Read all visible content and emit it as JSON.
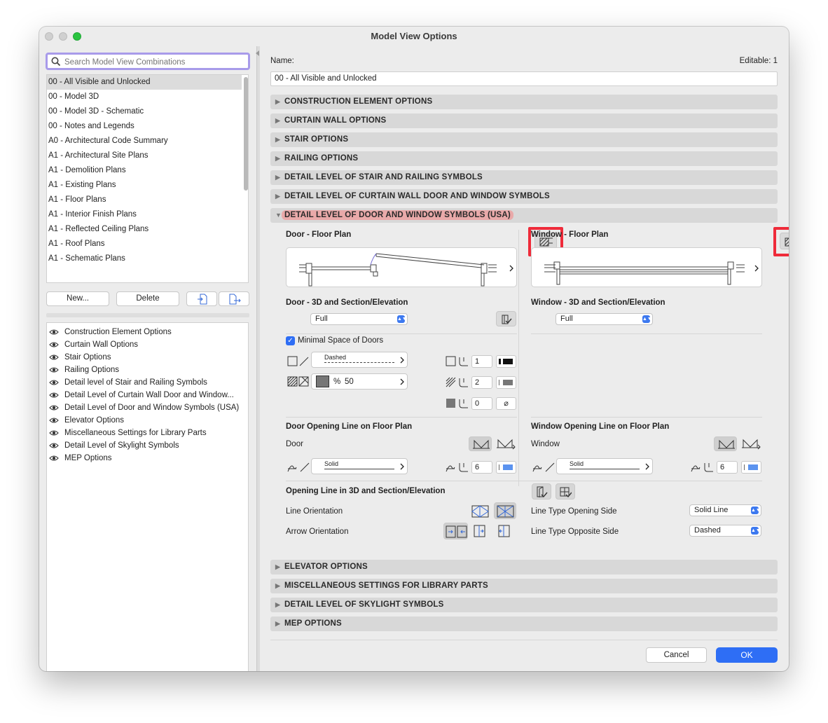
{
  "window": {
    "title": "Model View Options"
  },
  "left": {
    "search_placeholder": "Search Model View Combinations",
    "combinations": [
      "00 - All Visible and Unlocked",
      "00 - Model 3D",
      "00 - Model 3D - Schematic",
      "00 - Notes and Legends",
      "A0 - Architectural Code Summary",
      "A1 - Architectural Site Plans",
      "A1 - Demolition Plans",
      "A1 - Existing Plans",
      "A1 - Floor Plans",
      "A1 - Interior Finish Plans",
      "A1 - Reflected Ceiling Plans",
      "A1 - Roof Plans",
      "A1 - Schematic Plans"
    ],
    "new_label": "New...",
    "delete_label": "Delete",
    "option_sets": [
      "Construction Element Options",
      "Curtain Wall Options",
      "Stair Options",
      "Railing Options",
      "Detail level of Stair and Railing Symbols",
      "Detail Level of Curtain Wall Door and Window...",
      "Detail Level of Door and Window Symbols (USA)",
      "Elevator Options",
      "Miscellaneous Settings for Library Parts",
      "Detail Level of Skylight Symbols",
      "MEP Options"
    ]
  },
  "right": {
    "name_label": "Name:",
    "editable_label": "Editable: 1",
    "name_value": "00 - All Visible and Unlocked",
    "sections_top": [
      "CONSTRUCTION ELEMENT OPTIONS",
      "CURTAIN WALL OPTIONS",
      "STAIR OPTIONS",
      "RAILING OPTIONS",
      "DETAIL LEVEL OF STAIR AND RAILING SYMBOLS",
      "DETAIL LEVEL OF CURTAIN WALL DOOR AND WINDOW SYMBOLS"
    ],
    "expanded_section": "DETAIL LEVEL OF DOOR AND WINDOW SYMBOLS (USA)",
    "sections_bottom": [
      "ELEVATOR OPTIONS",
      "MISCELLANEOUS SETTINGS FOR LIBRARY PARTS",
      "DETAIL LEVEL OF SKYLIGHT SYMBOLS",
      "MEP OPTIONS"
    ],
    "door": {
      "floor_plan_label": "Door - Floor Plan",
      "section_label": "Door - 3D and Section/Elevation",
      "section_value": "Full",
      "minimal_space_label": "Minimal Space of Doors",
      "line_type_value": "Dashed",
      "fill_percent_symbol": "%",
      "fill_percent": "50",
      "pen1": "1",
      "pen2": "2",
      "pen3": "0",
      "opening_line_title": "Door Opening Line on Floor Plan",
      "opening_line_sub": "Door",
      "opening_line_type": "Solid",
      "opening_pen": "6"
    },
    "window": {
      "floor_plan_label": "Window - Floor Plan",
      "section_label": "Window - 3D and Section/Elevation",
      "section_value": "Full",
      "opening_line_title": "Window Opening Line on Floor Plan",
      "opening_line_sub": "Window",
      "opening_line_type": "Solid",
      "opening_pen": "6"
    },
    "opening3d": {
      "title": "Opening Line in 3D and Section/Elevation",
      "line_orientation": "Line Orientation",
      "arrow_orientation": "Arrow Orientation",
      "line_type_opening_side": "Line Type Opening Side",
      "line_type_opening_value": "Solid Line",
      "line_type_opposite_side": "Line Type Opposite Side",
      "line_type_opposite_value": "Dashed"
    },
    "cancel_label": "Cancel",
    "ok_label": "OK"
  },
  "colors": {
    "accent": "#2e6ef5",
    "highlight_box": "#ef2b3a",
    "search_ring": "#a89bea",
    "expanded_header_bg": "#e9a9a9"
  }
}
